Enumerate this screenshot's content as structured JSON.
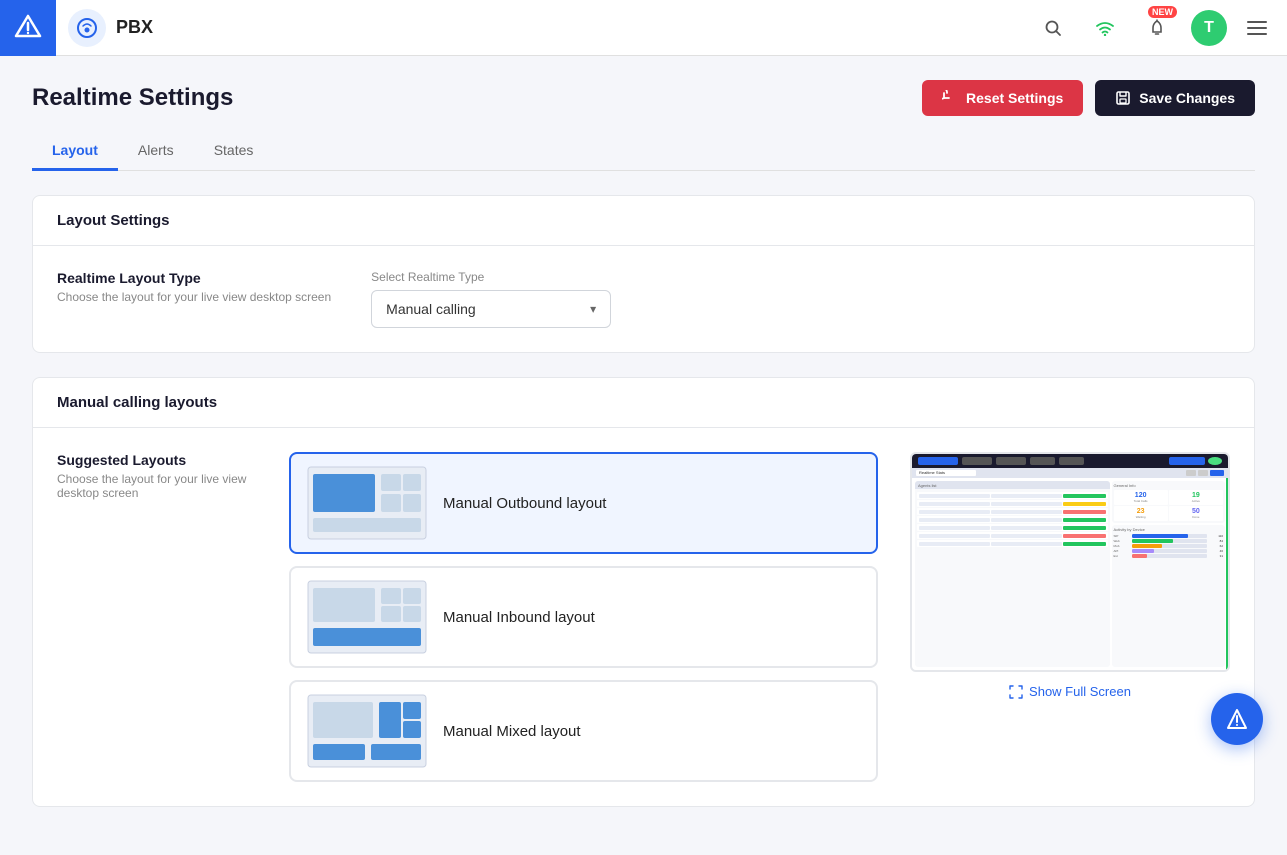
{
  "topbar": {
    "logo_alt": "logo",
    "app_name": "PBX",
    "new_badge": "new",
    "avatar_letter": "T"
  },
  "page": {
    "title": "Realtime Settings",
    "tabs": [
      {
        "id": "layout",
        "label": "Layout",
        "active": true
      },
      {
        "id": "alerts",
        "label": "Alerts",
        "active": false
      },
      {
        "id": "states",
        "label": "States",
        "active": false
      }
    ]
  },
  "header_actions": {
    "reset_label": "Reset Settings",
    "save_label": "Save Changes"
  },
  "layout_settings": {
    "section_title": "Layout Settings",
    "type_label": "Realtime Layout Type",
    "type_description": "Choose the layout for your live view desktop screen",
    "select_label": "Select Realtime Type",
    "selected_value": "Manual calling"
  },
  "manual_layouts": {
    "section_title": "Manual calling layouts",
    "suggested_label": "Suggested Layouts",
    "suggested_description": "Choose the layout for your live view desktop screen",
    "items": [
      {
        "id": "outbound",
        "label": "Manual Outbound layout",
        "selected": true
      },
      {
        "id": "inbound",
        "label": "Manual Inbound layout",
        "selected": false
      },
      {
        "id": "mixed",
        "label": "Manual Mixed layout",
        "selected": false
      }
    ],
    "preview_action": "Show Full Screen"
  }
}
